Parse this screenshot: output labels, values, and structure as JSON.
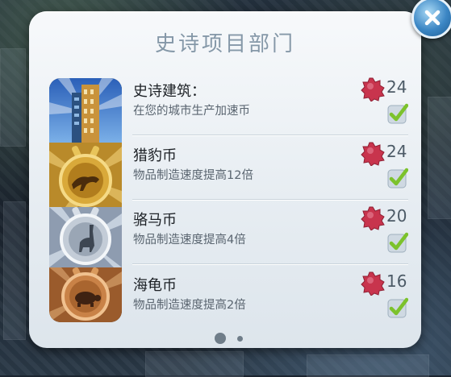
{
  "dialog": {
    "title": "史诗项目部门",
    "close_icon": "close-icon"
  },
  "items": [
    {
      "title": "史诗建筑：",
      "description": "在您的城市生产加速币",
      "count": "24",
      "completed": true,
      "icon": "epic-building-icon"
    },
    {
      "title": "猎豹币",
      "description": "物品制造速度提高12倍",
      "count": "24",
      "completed": true,
      "icon": "cheetah-coin-icon"
    },
    {
      "title": "骆马币",
      "description": "物品制造速度提高4倍",
      "count": "20",
      "completed": true,
      "icon": "llama-coin-icon"
    },
    {
      "title": "海龟币",
      "description": "物品制造速度提高2倍",
      "count": "16",
      "completed": true,
      "icon": "turtle-coin-icon"
    }
  ],
  "pagination": {
    "pages": 2,
    "current": 1
  },
  "colors": {
    "badge": "#c8344d",
    "check": "#7cc22c",
    "close": "#3b86c4"
  }
}
